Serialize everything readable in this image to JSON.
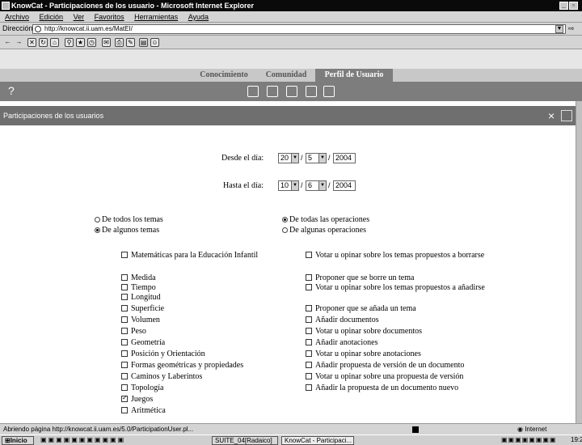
{
  "window": {
    "title": "KnowCat - Participaciones de los usuario - Microsoft Internet Explorer"
  },
  "menu": [
    "Archivo",
    "Edición",
    "Ver",
    "Favoritos",
    "Herramientas",
    "Ayuda"
  ],
  "address": {
    "label": "Dirección",
    "url": "http://knowcat.ii.uam.es/MatEI/"
  },
  "app_tabs": [
    "Conocimiento",
    "Comunidad",
    "Perfil de Usuario"
  ],
  "nav": {
    "help_label": "?"
  },
  "section": {
    "title": "Participaciones de los usuarios",
    "close": "×"
  },
  "form": {
    "desde_label": "Desde el día:",
    "desde": {
      "day": "20",
      "month": "5",
      "year": "2004"
    },
    "hasta_label": "Hasta el día:",
    "hasta": {
      "day": "10",
      "month": "6",
      "year": "2004"
    },
    "sep": "/",
    "temas_all": "De todos los temas",
    "temas_some": "De algunos temas",
    "ops_all": "De todas las operaciones",
    "ops_some": "De algunas operaciones",
    "themes": [
      {
        "label": "Matemáticas para la Educación Infantil",
        "checked": false
      },
      {
        "label": "Medida",
        "checked": false
      },
      {
        "label": "Tiempo",
        "checked": false
      },
      {
        "label": "Longitud",
        "checked": false
      },
      {
        "label": "Superficie",
        "checked": false
      },
      {
        "label": "Volumen",
        "checked": false
      },
      {
        "label": "Peso",
        "checked": false
      },
      {
        "label": "Geometría",
        "checked": false
      },
      {
        "label": "Posición y Orientación",
        "checked": false
      },
      {
        "label": "Formas geométricas y propiedades",
        "checked": false
      },
      {
        "label": "Caminos y Laberintos",
        "checked": false
      },
      {
        "label": "Topología",
        "checked": false
      },
      {
        "label": "Juegos",
        "checked": true
      },
      {
        "label": "Aritmética",
        "checked": false
      }
    ],
    "operations": [
      {
        "label": "Votar u opinar sobre los temas propuestos a borrarse",
        "checked": false
      },
      {
        "label": "Proponer que se borre un tema",
        "checked": false
      },
      {
        "label": "Votar u opinar sobre los temas propuestos a añadirse",
        "checked": false
      },
      {
        "label": "Proponer que se añada un tema",
        "checked": false
      },
      {
        "label": "Añadir documentos",
        "checked": false
      },
      {
        "label": "Votar u opinar sobre documentos",
        "checked": false
      },
      {
        "label": "Añadir anotaciones",
        "checked": false
      },
      {
        "label": "Votar u opinar sobre anotaciones",
        "checked": false
      },
      {
        "label": "Añadir propuesta de versión de un documento",
        "checked": false
      },
      {
        "label": "Votar u opinar sobre una propuesta de versión",
        "checked": false
      },
      {
        "label": "Añadir la propuesta de un documento nuevo",
        "checked": false
      }
    ]
  },
  "status": {
    "text": "Abriendo página http://knowcat.ii.uam.es/5.0/ParticipationUser.pl...",
    "zone": "Internet"
  },
  "taskbar": {
    "start": "Inicio",
    "tasks": [
      "SUITE_04[Radaico]",
      "KnowCat - Participaci..."
    ],
    "clock": "19:2"
  }
}
